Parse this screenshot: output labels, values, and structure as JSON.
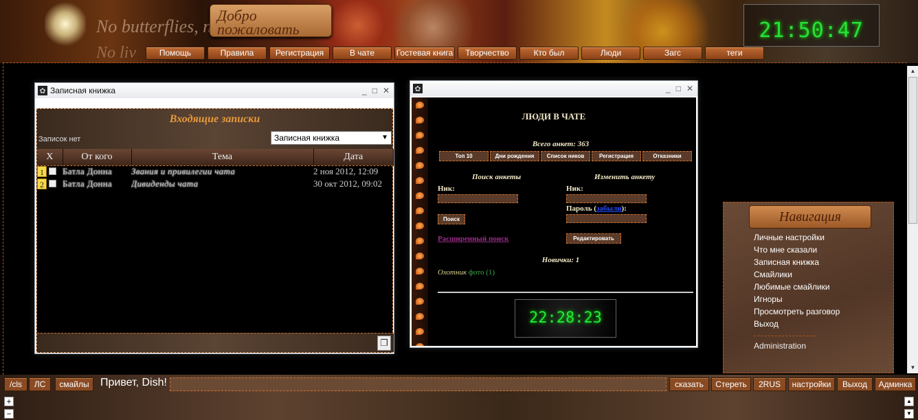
{
  "header": {
    "poem_line1": "No butterflies, no",
    "poem_line2": "No liv",
    "welcome": "Добро пожаловать",
    "clock": "21:50:47",
    "nav": [
      {
        "label": "Помощь",
        "w": 86
      },
      {
        "label": "Правила",
        "w": 86
      },
      {
        "label": "Регистрация",
        "w": 88
      },
      {
        "label": "В чате",
        "w": 86
      },
      {
        "label": "Гостевая книга",
        "w": 88
      },
      {
        "label": "Творчество",
        "w": 86
      },
      {
        "label": "Кто был",
        "w": 86
      },
      {
        "label": "Люди",
        "w": 86
      },
      {
        "label": "Загс",
        "w": 86
      },
      {
        "label": "теги",
        "w": 86
      }
    ]
  },
  "notebook": {
    "window_title": "Записная книжка",
    "heading": "Входящие записки",
    "empty_text": "Записок нет",
    "select_value": "Записная книжка",
    "columns": [
      "X",
      "От кого",
      "Тема",
      "Дата"
    ],
    "rows": [
      {
        "num": "1",
        "from": "Батла Донна",
        "subject": "Звания и привилегии чата",
        "date": "2 ноя 2012, 12:09"
      },
      {
        "num": "2",
        "from": "Батла Донна",
        "subject": "Дивиденды чата",
        "date": "30 окт 2012, 09:02"
      }
    ]
  },
  "people": {
    "title": "ЛЮДИ В ЧАТЕ",
    "total": "Всего анкет: 363",
    "tabs": [
      "Топ 10",
      "Дни рождения",
      "Список ников",
      "Регистрация",
      "Отказники"
    ],
    "search_heading": "Поиск анкеты",
    "edit_heading": "Изменить анкету",
    "nick_label": "Ник:",
    "nick_label2": "Ник:",
    "password_label": "Пароль (",
    "forgot": "забыли",
    "password_end": "):",
    "search_button": "Поиск",
    "edit_button": "Редактировать",
    "advanced_search": "Расширенный поиск",
    "newbies": "Новички: 1",
    "newbie_name": "Охотник",
    "newbie_photo": "фото (1)",
    "clock": "22:28:23"
  },
  "navigation": {
    "heading": "Навигация",
    "items": [
      "Личные настройки",
      "Что мне сказали",
      "Записная книжка",
      "Смайлики",
      "Любимые смайлики",
      "Игноры",
      "Просмотреть разговор",
      "Выход"
    ],
    "admin": "Administration"
  },
  "bottom": {
    "left_buttons": [
      "/cls",
      "ЛС",
      "смайлы"
    ],
    "greeting": "Привет, Dish!",
    "right_buttons": [
      "сказать",
      "Стереть",
      "2RUS",
      "настройки",
      "Выход",
      "Админка"
    ]
  },
  "colors": {
    "accent": "#c8702e",
    "clock_green": "#28e03a",
    "heading_orange": "#e79a3a"
  }
}
